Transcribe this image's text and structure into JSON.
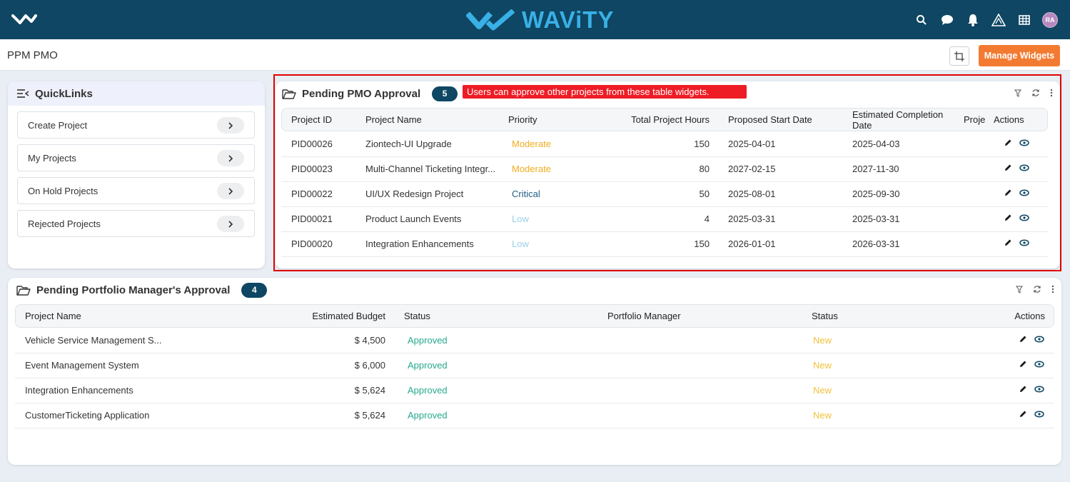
{
  "nav": {
    "brand": "WAViTY",
    "avatar_initials": "RA",
    "icons": [
      "logo-check-icon",
      "search-icon",
      "chat-icon",
      "bell-icon",
      "warning-icon",
      "grid-icon"
    ],
    "colors": {
      "topbar": "#0e4663",
      "brand_blue": "#39b0e6",
      "accent_orange": "#f37b31"
    }
  },
  "subbar": {
    "title": "PPM PMO",
    "manage_widgets": "Manage Widgets"
  },
  "quicklinks": {
    "title": "QuickLinks",
    "items": [
      {
        "label": "Create Project"
      },
      {
        "label": "My Projects"
      },
      {
        "label": "On Hold Projects"
      },
      {
        "label": "Rejected Projects"
      }
    ]
  },
  "pmo": {
    "title": "Pending PMO Approval",
    "count": "5",
    "tooltip": "Users can approve other projects from these table widgets.",
    "columns": [
      "Project ID",
      "Project Name",
      "Priority",
      "Total Project Hours",
      "Proposed Start Date",
      "Estimated Completion Date",
      "Proje",
      "Actions"
    ],
    "rows": [
      {
        "id": "PID00026",
        "name": "Ziontech-UI Upgrade",
        "priority": "Moderate",
        "hours": "150",
        "start": "2025-04-01",
        "end": "2025-04-03"
      },
      {
        "id": "PID00023",
        "name": "Multi-Channel Ticketing Integr...",
        "priority": "Moderate",
        "hours": "80",
        "start": "2027-02-15",
        "end": "2027-11-30"
      },
      {
        "id": "PID00022",
        "name": "UI/UX Redesign Project",
        "priority": "Critical",
        "hours": "50",
        "start": "2025-08-01",
        "end": "2025-09-30"
      },
      {
        "id": "PID00021",
        "name": "Product Launch Events",
        "priority": "Low",
        "hours": "4",
        "start": "2025-03-31",
        "end": "2025-03-31"
      },
      {
        "id": "PID00020",
        "name": "Integration Enhancements",
        "priority": "Low",
        "hours": "150",
        "start": "2026-01-01",
        "end": "2026-03-31"
      }
    ]
  },
  "pm": {
    "title": "Pending Portfolio Manager's Approval",
    "count": "4",
    "columns": [
      "Project Name",
      "Estimated Budget",
      "Status",
      "Portfolio Manager",
      "Status",
      "Actions"
    ],
    "rows": [
      {
        "name": "Vehicle Service Management S...",
        "budget": "$ 4,500",
        "status": "Approved",
        "manager": "",
        "status2": "New"
      },
      {
        "name": "Event Management System",
        "budget": "$ 6,000",
        "status": "Approved",
        "manager": "",
        "status2": "New"
      },
      {
        "name": "Integration Enhancements",
        "budget": "$ 5,624",
        "status": "Approved",
        "manager": "",
        "status2": "New"
      },
      {
        "name": "CustomerTicketing Application",
        "budget": "$ 5,624",
        "status": "Approved",
        "manager": "",
        "status2": "New"
      }
    ]
  }
}
